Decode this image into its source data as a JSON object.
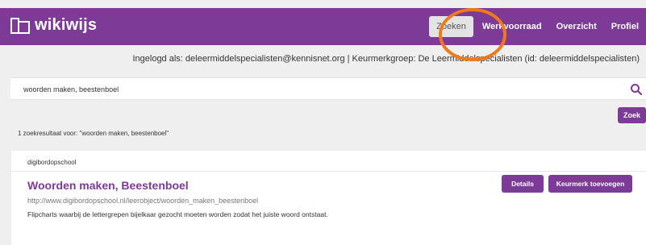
{
  "header": {
    "logo_text": "wikiwijs",
    "nav": [
      {
        "label": "Zoeken",
        "active": true
      },
      {
        "label": "Werkvoorraad"
      },
      {
        "label": "Overzicht"
      },
      {
        "label": "Profiel"
      }
    ]
  },
  "login_info": "Ingelogd als: deleermiddelspecialisten@kennisnet.org | Keurmerkgroep: De Leermiddelspecialisten (id: deleermiddelspecialisten)",
  "search": {
    "value": "woorden maken, beestenboel",
    "button_label": "Zoek"
  },
  "results_summary": "1 zoekresultaat voor: \"woorden maken, beestenboel\"",
  "result": {
    "source": "digibordopschool",
    "title": "Woorden maken, Beestenboel",
    "url": "http://www.digibordopschool.nl/leerobject/woorden_maken_beestenboel",
    "description": "Flipcharts waarbij de lettergrepen bijelkaar gezocht moeten worden zodat het juiste woord ontstaat.",
    "details_label": "Details",
    "keurmerk_label": "Keurmerk toevoegen"
  },
  "colors": {
    "brand": "#7d3a96",
    "annotation": "#f07a1a"
  },
  "icons": {
    "logo": "wikiwijs-logo-icon",
    "search": "search-icon"
  }
}
